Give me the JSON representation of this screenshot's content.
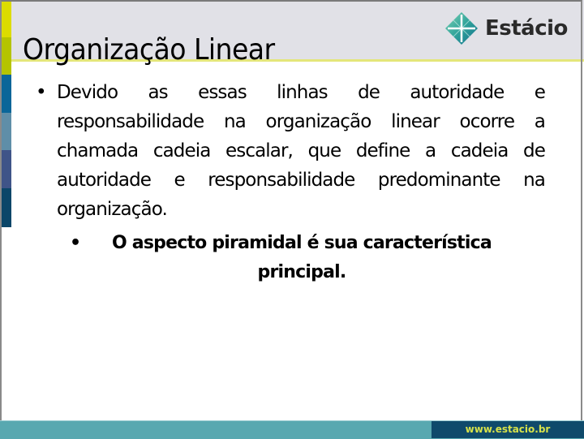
{
  "slide": {
    "title": "Organização Linear",
    "logo": {
      "icon": "estacio-diamond-icon",
      "text": "Estácio"
    },
    "bullets": [
      {
        "level": 1,
        "text": "Devido as essas linhas de autoridade e responsabilidade na organização linear ocorre a chamada cadeia escalar, que define a cadeia de autoridade e responsabilidade predominante na organização."
      },
      {
        "level": 2,
        "text": "O aspecto piramidal é sua característica principal.",
        "bold": true
      }
    ],
    "bullet_glyph": "•",
    "footer_url": "www.estacio.br"
  },
  "colors": {
    "header_bg": "#e1e1e7",
    "header_line": "#e4e67a",
    "stripe": [
      "#dcdc00",
      "#b5c400",
      "#0a6699",
      "#5f8ea8",
      "#3f5488",
      "#0b4669"
    ],
    "footer_teal": "#58a8b0",
    "footer_dark": "#0f4a6b",
    "footer_text": "#d7e24a"
  }
}
